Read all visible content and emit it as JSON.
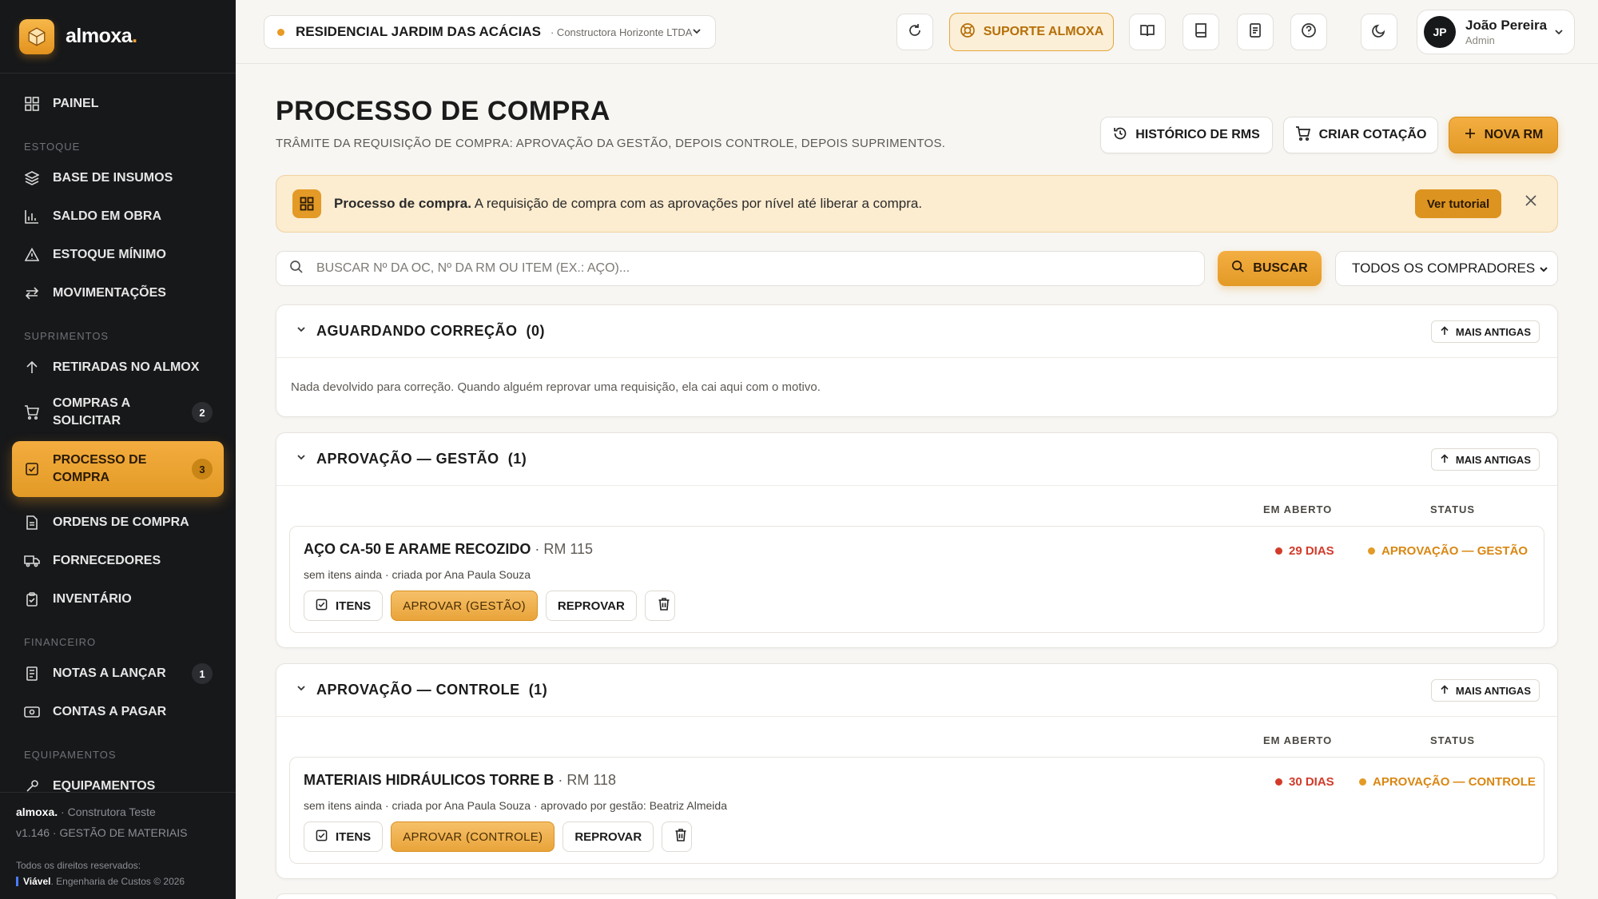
{
  "app": {
    "name": "almoxa",
    "name_dot": "."
  },
  "colors": {
    "accent": "#e39a26",
    "accent_light": "#fcecd0",
    "sidebar_bg": "#17181a",
    "danger": "#d23b2a",
    "status": "#d98712"
  },
  "sidebar": {
    "painel": "PAINEL",
    "sections": {
      "estoque": "ESTOQUE",
      "suprimentos": "SUPRIMENTOS",
      "financeiro": "FINANCEIRO",
      "equipamentos": "EQUIPAMENTOS"
    },
    "items": {
      "base_insumos": "BASE DE INSUMOS",
      "saldo_obra": "SALDO EM OBRA",
      "estoque_minimo": "ESTOQUE MÍNIMO",
      "movimentacoes": "MOVIMENTAÇÕES",
      "retiradas": "RETIRADAS NO ALMOX",
      "compras_l1": "COMPRAS A",
      "compras_l2": "SOLICITAR",
      "compras_badge": "2",
      "processo_l1": "PROCESSO DE",
      "processo_l2": "COMPRA",
      "processo_badge": "3",
      "ordens": "ORDENS DE COMPRA",
      "fornecedores": "FORNECEDORES",
      "inventario": "INVENTÁRIO",
      "notas": "NOTAS A LANÇAR",
      "notas_badge": "1",
      "contas": "CONTAS A PAGAR",
      "equipamentos": "EQUIPAMENTOS"
    },
    "footer": {
      "brand": "almoxa.",
      "company": "Construtora Teste",
      "version": "v1.146 · GESTÃO DE MATERIAIS",
      "rights": "Todos os direitos reservados:",
      "maker": "Viável",
      "maker_rest": ". Engenharia de Custos © 2026"
    }
  },
  "topbar": {
    "project_name": "RESIDENCIAL JARDIM DAS ACÁCIAS",
    "project_company": "· Constructora Horizonte LTDA",
    "support_label": "SUPORTE ALMOXA",
    "user_initials": "JP",
    "user_name": "João Pereira",
    "user_role": "Admin"
  },
  "page": {
    "title": "PROCESSO DE COMPRA",
    "subtitle": "TRÂMITE DA REQUISIÇÃO DE COMPRA: APROVAÇÃO DA GESTÃO, DEPOIS CONTROLE, DEPOIS SUPRIMENTOS.",
    "btn_historico": "HISTÓRICO DE RMS",
    "btn_cotacao": "CRIAR COTAÇÃO",
    "btn_nova": "NOVA RM"
  },
  "banner": {
    "title": "Processo de compra.",
    "text": " A requisição de compra com as aprovações por nível até liberar a compra.",
    "tutorial": "Ver tutorial"
  },
  "search": {
    "placeholder": "BUSCAR Nº DA OC, Nº DA RM OU ITEM (EX.: AÇO)...",
    "button": "BUSCAR",
    "buyers_selected": "TODOS OS COMPRADORES"
  },
  "sections": {
    "correcao": {
      "title": "AGUARDANDO CORREÇÃO",
      "count": "(0)",
      "sort": "MAIS ANTIGAS",
      "empty": "Nada devolvido para correção. Quando alguém reprovar uma requisição, ela cai aqui com o motivo."
    },
    "gestao": {
      "title": "APROVAÇÃO — GESTÃO",
      "count": "(1)",
      "sort": "MAIS ANTIGAS",
      "col_aberto": "EM ABERTO",
      "col_status": "STATUS",
      "card": {
        "title": "AÇO CA-50 E ARAME RECOZIDO",
        "rm": " · RM 115",
        "meta": "sem itens ainda · criada por Ana Paula Souza",
        "days": "29 DIAS",
        "status": "APROVAÇÃO — GESTÃO",
        "btn_itens": "ITENS",
        "btn_aprovar": "APROVAR (GESTÃO)",
        "btn_reprovar": "REPROVAR"
      }
    },
    "controle": {
      "title": "APROVAÇÃO — CONTROLE",
      "count": "(1)",
      "sort": "MAIS ANTIGAS",
      "col_aberto": "EM ABERTO",
      "col_status": "STATUS",
      "card": {
        "title": "MATERIAIS HIDRÁULICOS TORRE B",
        "rm": " · RM 118",
        "meta": "sem itens ainda · criada por Ana Paula Souza · aprovado por gestão: Beatriz Almeida",
        "days": "30 DIAS",
        "status": "APROVAÇÃO — CONTROLE",
        "btn_itens": "ITENS",
        "btn_aprovar": "APROVAR (CONTROLE)",
        "btn_reprovar": "REPROVAR"
      }
    }
  }
}
